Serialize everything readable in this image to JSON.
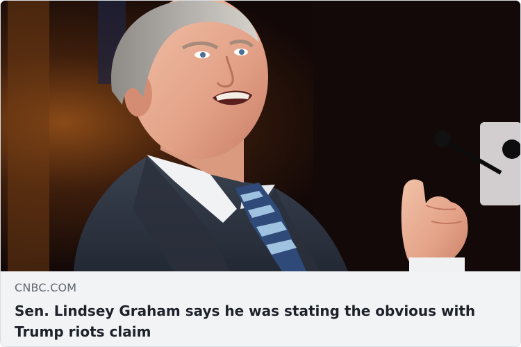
{
  "link_card": {
    "image": {
      "subject": "man-in-suit-speaking-with-raised-fist"
    },
    "source_domain": "CNBC.COM",
    "headline": "Sen. Lindsey Graham says he was stating the obvious with Trump riots claim"
  },
  "colors": {
    "caption_background": "#f2f3f5",
    "domain_text": "#606770",
    "headline_text": "#1d2129"
  }
}
